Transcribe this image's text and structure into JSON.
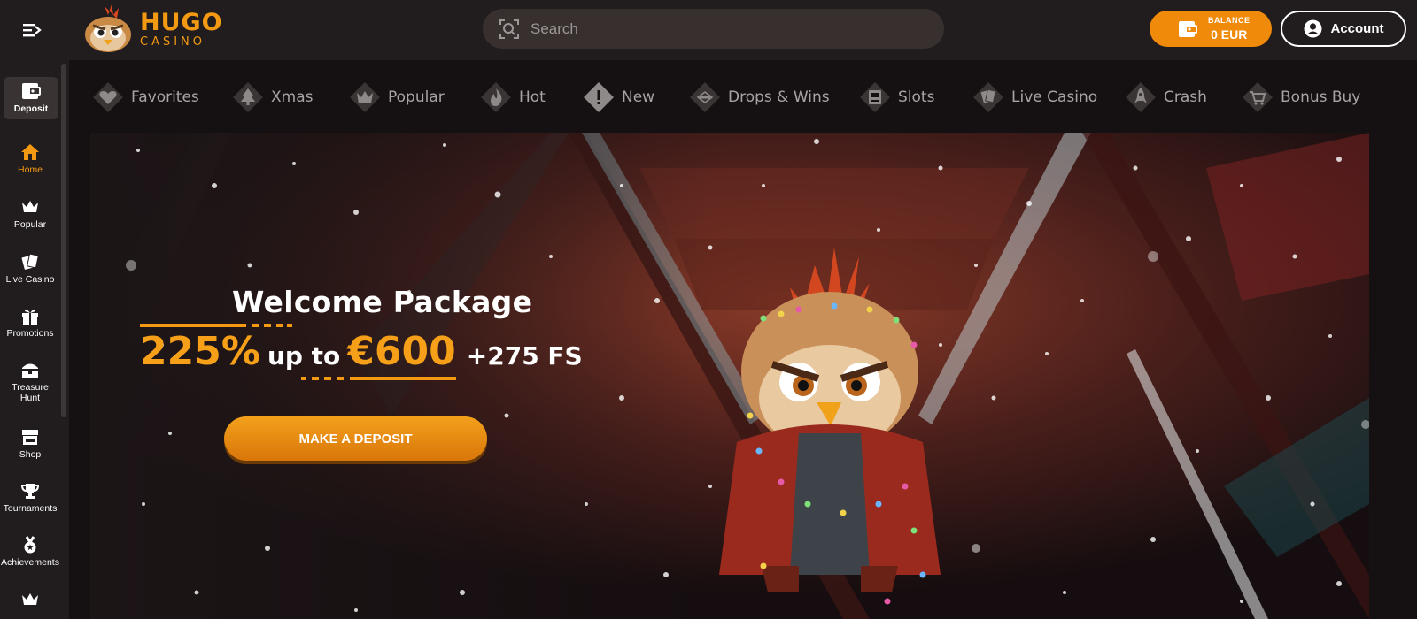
{
  "header": {
    "logo": {
      "name": "HUGO",
      "sub": "CASINO"
    },
    "search": {
      "placeholder": "Search"
    },
    "balance": {
      "label": "BALANCE",
      "value": "0 EUR"
    },
    "account": {
      "label": "Account"
    }
  },
  "sidebar": {
    "deposit": {
      "label": "Deposit",
      "icon": "wallet-icon"
    },
    "items": [
      {
        "label": "Home",
        "icon": "home-icon",
        "active": true
      },
      {
        "label": "Popular",
        "icon": "crown-icon"
      },
      {
        "label": "Live Casino",
        "icon": "cards-icon"
      },
      {
        "label": "Promotions",
        "icon": "gift-icon"
      },
      {
        "label": "Treasure Hunt",
        "icon": "chest-icon"
      },
      {
        "label": "Shop",
        "icon": "shop-icon"
      },
      {
        "label": "Tournaments",
        "icon": "trophy-icon"
      },
      {
        "label": "Achievements",
        "icon": "medal-icon"
      }
    ]
  },
  "categories": [
    {
      "label": "Favorites",
      "icon": "heart-icon"
    },
    {
      "label": "Xmas",
      "icon": "tree-icon"
    },
    {
      "label": "Popular",
      "icon": "crown-icon"
    },
    {
      "label": "Hot",
      "icon": "flame-icon"
    },
    {
      "label": "New",
      "icon": "exclamation-icon"
    },
    {
      "label": "Drops & Wins",
      "icon": "drops-wins-icon"
    },
    {
      "label": "Slots",
      "icon": "slot-machine-icon"
    },
    {
      "label": "Live Casino",
      "icon": "cards-icon"
    },
    {
      "label": "Crash",
      "icon": "rocket-icon"
    },
    {
      "label": "Bonus Buy",
      "icon": "cart-icon"
    }
  ],
  "banner": {
    "headline": "Welcome Package",
    "percent": "225%",
    "up_to": "up to",
    "amount": "€600",
    "free_spins": "+275 FS",
    "cta": "MAKE A DEPOSIT"
  },
  "colors": {
    "accent": "#f39a12",
    "bg": "#151112",
    "panel": "#211c1d"
  }
}
